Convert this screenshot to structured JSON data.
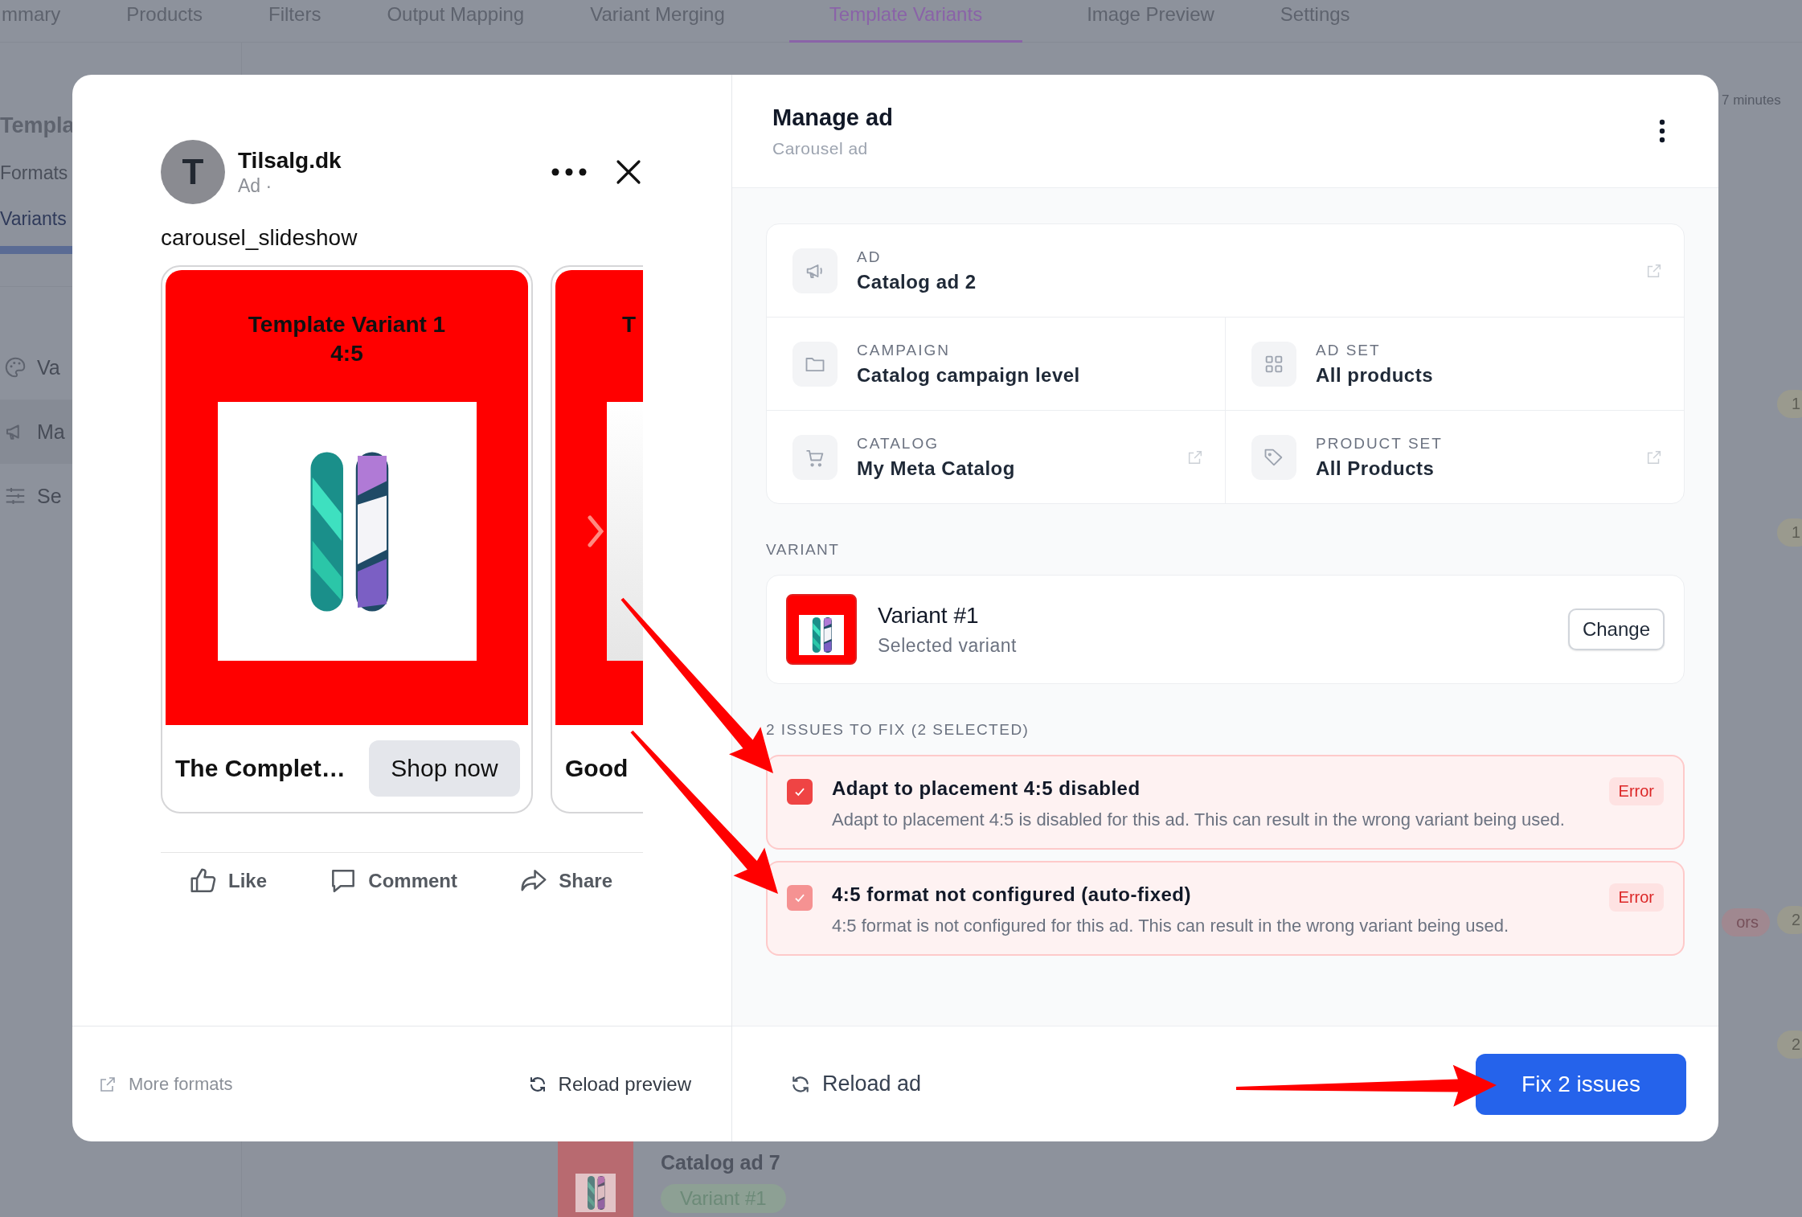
{
  "background": {
    "tabs": [
      {
        "label": "mmary",
        "selected": false
      },
      {
        "label": "Products",
        "selected": false
      },
      {
        "label": "Filters",
        "selected": false
      },
      {
        "label": "Output Mapping",
        "selected": false
      },
      {
        "label": "Variant Merging",
        "selected": false
      },
      {
        "label": "Template Variants",
        "selected": true
      },
      {
        "label": "Image Preview",
        "selected": false
      },
      {
        "label": "Settings",
        "selected": false
      }
    ],
    "sidebar": {
      "title": "Templa",
      "links": [
        {
          "label": "Formats",
          "selected": false
        },
        {
          "label": "Variants",
          "selected": true
        }
      ],
      "items": [
        {
          "kind": "palette",
          "label": "Va"
        },
        {
          "kind": "megaphone",
          "label": "Ma"
        },
        {
          "kind": "sliders",
          "label": "Se"
        }
      ]
    },
    "right_column": {
      "timestamp": "7 minutes",
      "badges": [
        {
          "label": "1",
          "kind": "count"
        },
        {
          "label": "1",
          "kind": "count"
        },
        {
          "label": "ors",
          "kind": "error"
        },
        {
          "label": "2",
          "kind": "count"
        },
        {
          "label": "2",
          "kind": "count"
        }
      ]
    },
    "list_row": {
      "title": "Catalog ad 7",
      "variant": "Variant #1"
    }
  },
  "preview": {
    "page": {
      "initial": "T",
      "name": "Tilsalg.dk",
      "meta": "Ad ·"
    },
    "caption": "carousel_slideshow",
    "cards": [
      {
        "headline": [
          "Template Variant 1",
          "4:5"
        ],
        "title": "The Complet…",
        "cta": "Shop now"
      },
      {
        "headline": [
          "T"
        ],
        "title": "Good"
      }
    ],
    "actions": [
      {
        "kind": "like",
        "label": "Like"
      },
      {
        "kind": "comment",
        "label": "Comment"
      },
      {
        "kind": "share",
        "label": "Share"
      }
    ],
    "footer": {
      "more": "More formats",
      "reload": "Reload preview"
    }
  },
  "manage": {
    "title": "Manage ad",
    "subtitle": "Carousel ad",
    "details": [
      [
        {
          "kind": "megaphone",
          "label": "AD",
          "value": "Catalog ad 2",
          "external": true
        }
      ],
      [
        {
          "kind": "folder",
          "label": "CAMPAIGN",
          "value": "Catalog campaign level",
          "external": false
        },
        {
          "kind": "grid",
          "label": "AD SET",
          "value": "All products",
          "external": false
        }
      ],
      [
        {
          "kind": "cart",
          "label": "CATALOG",
          "value": "My Meta Catalog",
          "external": true
        },
        {
          "kind": "tag",
          "label": "PRODUCT SET",
          "value": "All Products",
          "external": true
        }
      ]
    ],
    "variant_label": "VARIANT",
    "variant": {
      "name": "Variant #1",
      "note": "Selected variant",
      "button": "Change"
    },
    "issues_label": "2 ISSUES TO FIX (2 SELECTED)",
    "issues": [
      {
        "title": "Adapt to placement 4:5 disabled",
        "description": "Adapt to placement 4:5 is disabled for this ad. This can result in the wrong variant being used.",
        "badge": "Error",
        "checked": true,
        "disabled": false
      },
      {
        "title": "4:5 format not configured (auto-fixed)",
        "description": "4:5 format is not configured for this ad. This can result in the wrong variant being used.",
        "badge": "Error",
        "checked": true,
        "disabled": true
      }
    ],
    "reload": "Reload ad",
    "fix": "Fix 2 issues"
  }
}
